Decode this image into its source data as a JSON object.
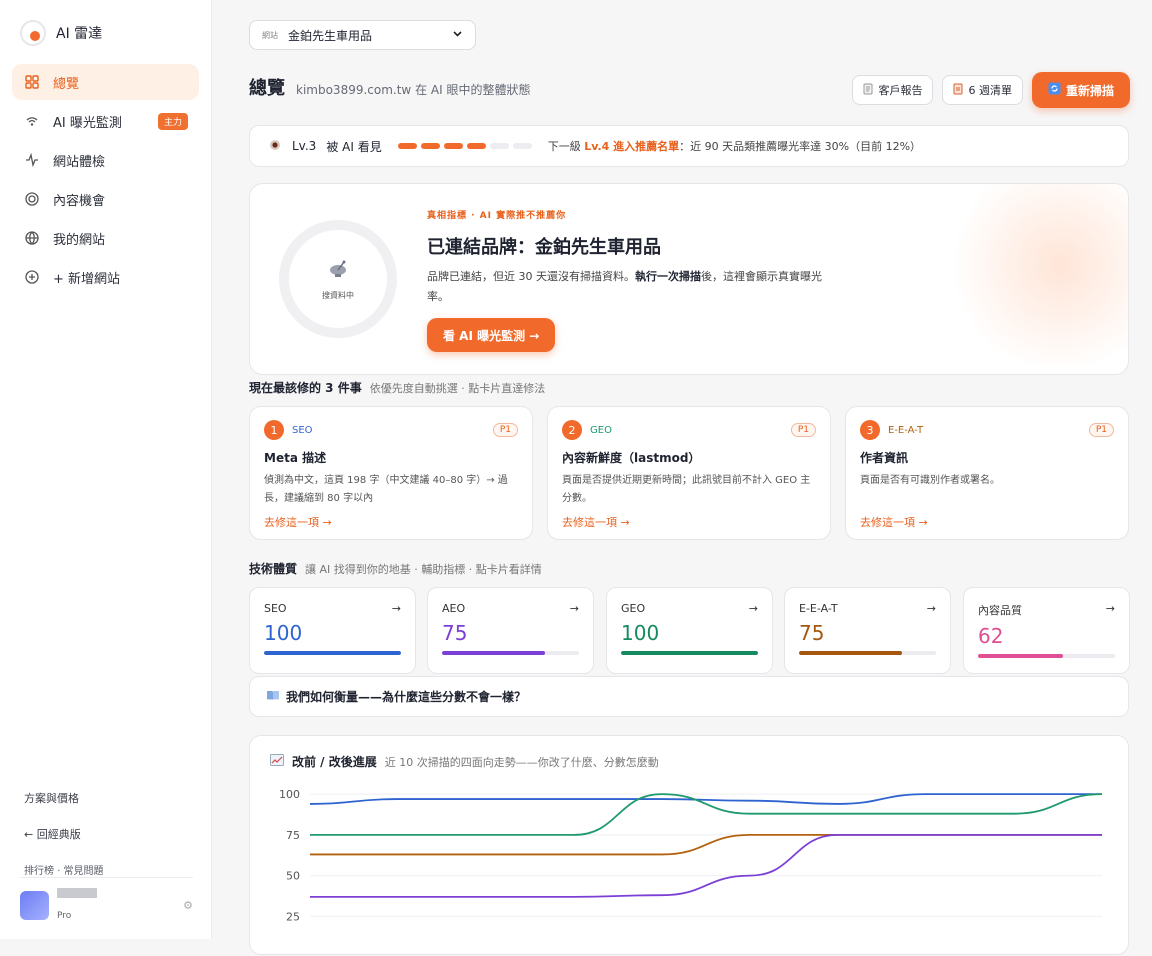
{
  "brand": {
    "name": "AI 雷達"
  },
  "sidebar": {
    "items": [
      {
        "label": "總覽",
        "icon": "grid-icon"
      },
      {
        "label": "AI 曝光監測",
        "icon": "signal-icon",
        "badge": "主力"
      },
      {
        "label": "網站體檢",
        "icon": "pulse-icon"
      },
      {
        "label": "內容機會",
        "icon": "target-icon"
      },
      {
        "label": "我的網站",
        "icon": "globe-icon"
      },
      {
        "label": "+ 新增網站",
        "icon": "plus-circle-icon"
      }
    ],
    "pricing": "方案與價格",
    "classic": "← 回經典版",
    "footer_links": [
      "排行榜",
      "常見問題"
    ],
    "user": {
      "plan": "Pro"
    }
  },
  "site_select": {
    "label": "網站",
    "value": "金鉑先生車用品"
  },
  "header": {
    "title": "總覽",
    "subtitle": "kimbo3899.com.tw 在 AI 眼中的整體狀態",
    "report_btn": "客戶報告",
    "weekly_btn": "6 週清單",
    "rescan_btn": "重新掃描"
  },
  "level": {
    "label": "Lv.3",
    "status": "被 AI 看見",
    "progress": 4,
    "total": 6,
    "next_prefix": "下一級 ",
    "next_level": "Lv.4 進入推薦名單",
    "next_suffix": "：近 90 天品類推薦曝光率達 30%（目前 12%）"
  },
  "hero": {
    "tag": "真相指標 · AI 實際推不推薦你",
    "ring_label": "搜資料中",
    "title": "已連結品牌：金鉑先生車用品",
    "desc_1": "品牌已連結，但近 30 天還沒有掃描資料。",
    "desc_bold": "執行一次掃描",
    "desc_2": "後，這裡會顯示真實曝光率。",
    "cta": "看 AI 曝光監測 →"
  },
  "fixes": {
    "heading": "現在最該修的 3 件事",
    "sub": "依優先度自動挑選 · 點卡片直達修法",
    "items": [
      {
        "num": "1",
        "category": "SEO",
        "color": "#3466d6",
        "priority": "P1",
        "title": "Meta 描述",
        "desc": "偵測為中文，這頁 198 字（中文建議 40–80 字）→ 過長，建議縮到 80 字以內",
        "link": "去修這一項 →"
      },
      {
        "num": "2",
        "category": "GEO",
        "color": "#1e9a6c",
        "priority": "P1",
        "title": "內容新鮮度（lastmod）",
        "desc": "頁面是否提供近期更新時間；此訊號目前不計入 GEO 主分數。",
        "link": "去修這一項 →"
      },
      {
        "num": "3",
        "category": "E-E-A-T",
        "color": "#b3610e",
        "priority": "P1",
        "title": "作者資訊",
        "desc": "頁面是否有可識別作者或署名。",
        "link": "去修這一項 →"
      }
    ]
  },
  "tech": {
    "heading": "技術體質",
    "sub": "讓 AI 找得到你的地基 · 輔助指標 · 點卡片看詳情",
    "scores": [
      {
        "label": "SEO",
        "value": "100",
        "fraction": 1.0,
        "color": "#2f63d0"
      },
      {
        "label": "AEO",
        "value": "75",
        "fraction": 0.75,
        "color": "#7c3fd6"
      },
      {
        "label": "GEO",
        "value": "100",
        "fraction": 1.0,
        "color": "#148a5f"
      },
      {
        "label": "E-E-A-T",
        "value": "75",
        "fraction": 0.75,
        "color": "#a5570f"
      },
      {
        "label": "內容品質",
        "value": "62",
        "fraction": 0.62,
        "color": "#de4f93"
      }
    ],
    "arrow": "→"
  },
  "measure": {
    "text": "我們如何衡量——為什麼這些分數不會一樣？",
    "icon": "book-icon"
  },
  "trend": {
    "title": "改前 / 改後進展",
    "sub": "近 10 次掃描的四面向走勢——你改了什麼、分數怎麼動",
    "icon": "chart-icon"
  },
  "chart_data": {
    "type": "line",
    "x": [
      1,
      2,
      3,
      4,
      5,
      6,
      7,
      8,
      9,
      10
    ],
    "yticks": [
      100,
      75,
      50,
      25
    ],
    "ylim": [
      15,
      105
    ],
    "grid": true,
    "series": [
      {
        "color": "#2f63d0",
        "values": [
          94,
          97,
          97,
          97,
          97,
          96,
          94,
          100,
          100,
          100
        ]
      },
      {
        "color": "#1e9a6c",
        "values": [
          75,
          75,
          75,
          75,
          100,
          88,
          88,
          88,
          88,
          100
        ]
      },
      {
        "color": "#b3610e",
        "values": [
          63,
          63,
          63,
          63,
          63,
          75,
          75,
          75,
          75,
          75
        ]
      },
      {
        "color": "#7c3fd6",
        "values": [
          37,
          37,
          37,
          37,
          38,
          50,
          75,
          75,
          75,
          75
        ]
      }
    ]
  }
}
